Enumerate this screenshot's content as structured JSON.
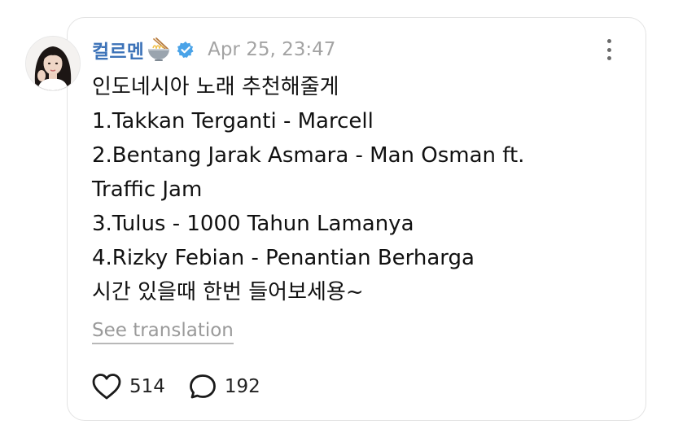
{
  "post": {
    "username": "컬르멘",
    "timestamp": "Apr 25, 23:47",
    "lines": [
      "인도네시아 노래 추천해줄게",
      "1.Takkan Terganti - Marcell",
      "2.Bentang Jarak Asmara - Man Osman ft.",
      "Traffic Jam",
      "3.Tulus - 1000 Tahun Lamanya",
      "4.Rizky Febian - Penantian Berharga",
      "시간 있을때 한번 들어보세용~"
    ],
    "see_translation": "See translation",
    "likes": "514",
    "replies": "192"
  },
  "icons": {
    "avatar": "user-avatar",
    "name_emoji": "ramen-bowl-icon",
    "verified": "verified-badge-icon",
    "more": "more-vertical-icon",
    "like": "heart-icon",
    "reply": "comment-bubble-icon"
  },
  "colors": {
    "username": "#3d73b8",
    "verified": "#4aa3e8",
    "timestamp": "#a3a3a3",
    "muted": "#9a9a9a"
  }
}
